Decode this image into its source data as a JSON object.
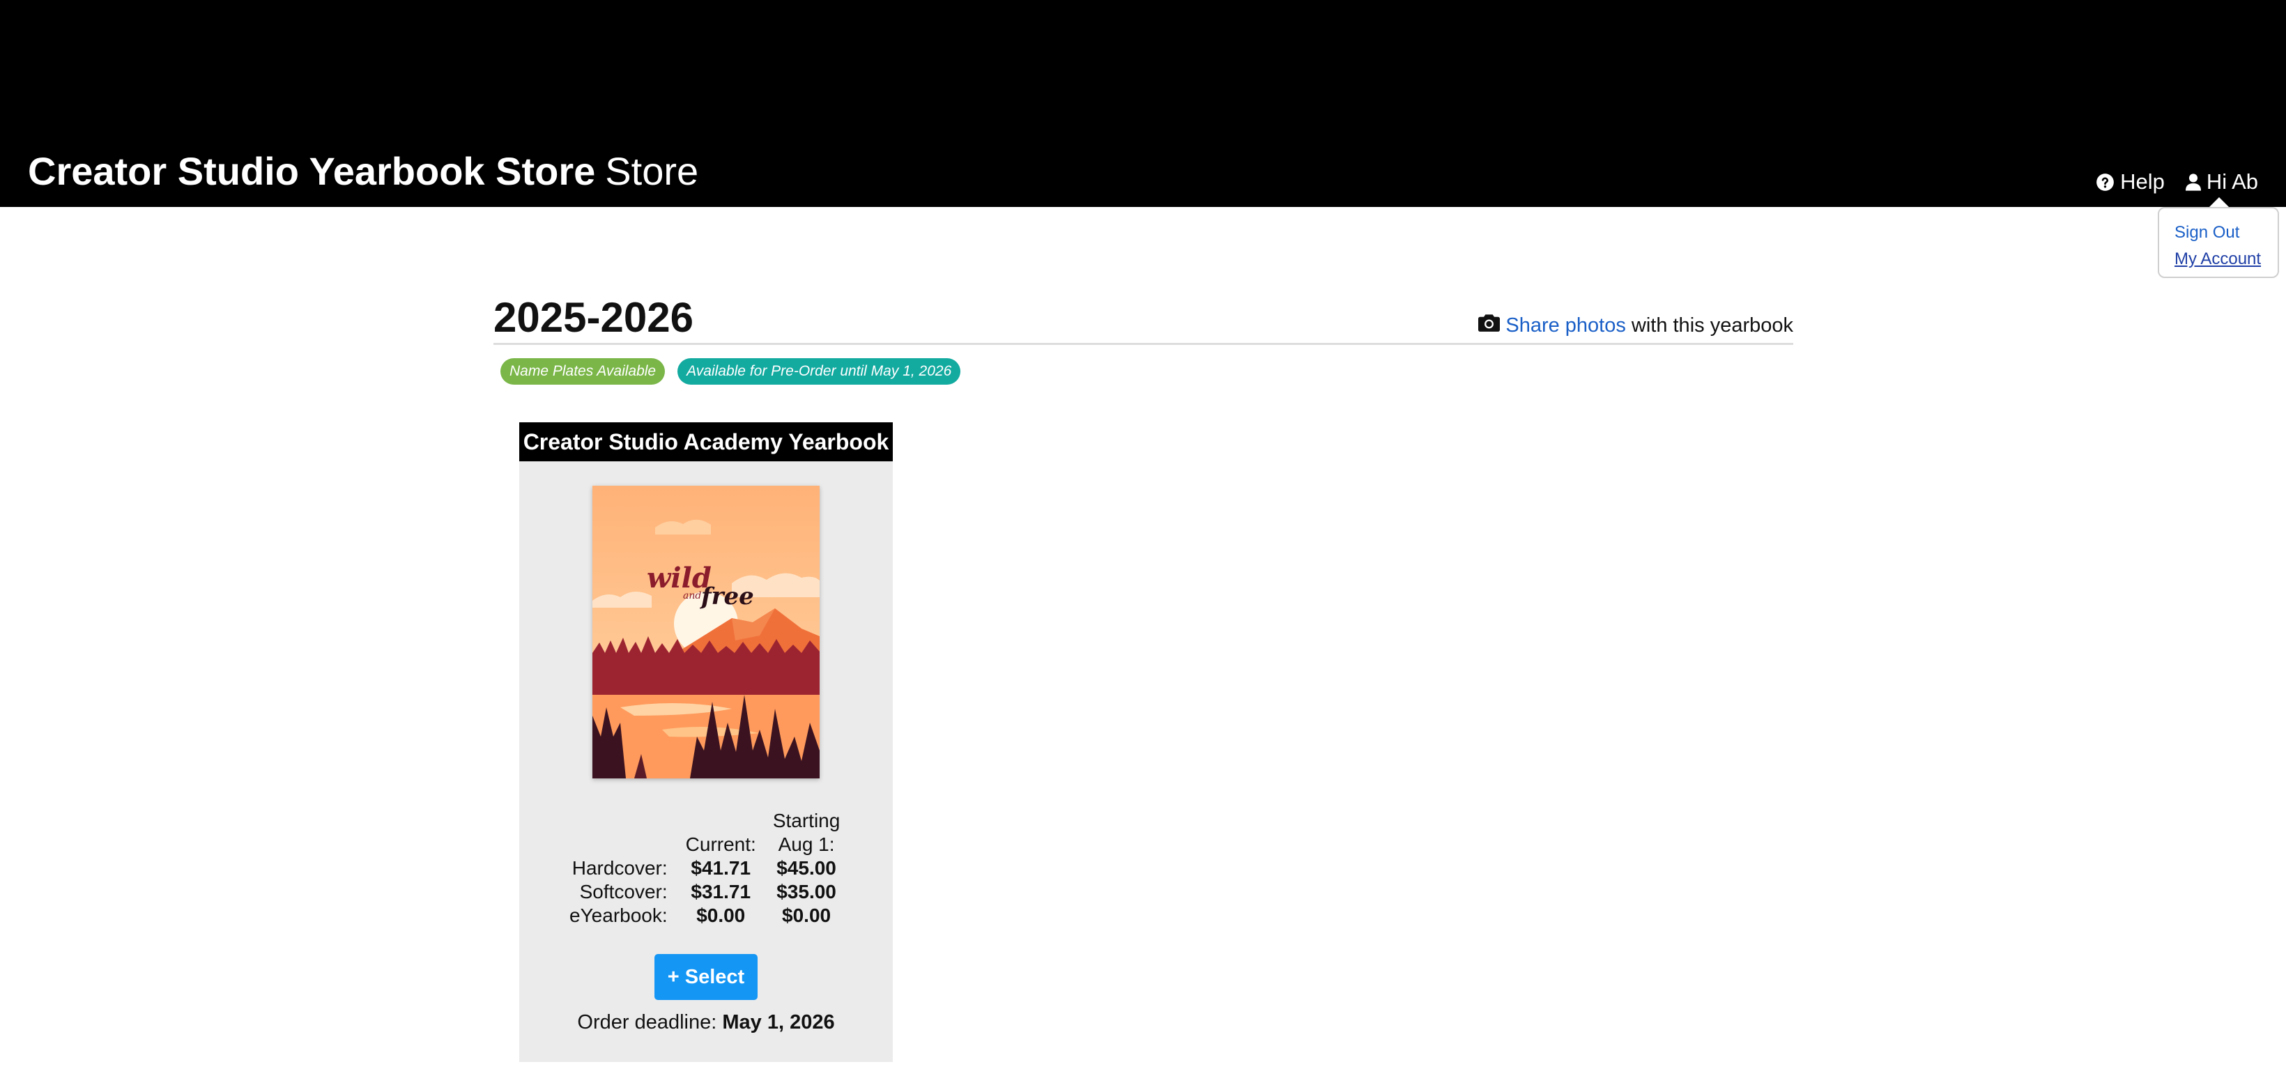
{
  "header": {
    "brand_bold": "Creator Studio Yearbook Store",
    "brand_light": "Store",
    "help_label": "Help",
    "user_label": "Hi Ab",
    "background": "#000000"
  },
  "user_menu": {
    "sign_out": "Sign Out",
    "my_account": "My Account"
  },
  "main": {
    "title": "2025-2026",
    "share_link": "Share photos",
    "share_rest": "with this yearbook",
    "badges": [
      {
        "label": "Name Plates Available",
        "color": "#7ab648"
      },
      {
        "label": "Available for Pre-Order until May 1, 2026",
        "color": "#13aaa0"
      }
    ]
  },
  "product": {
    "title": "Creator Studio Academy Yearbook",
    "cover_text_1": "wild",
    "cover_text_2": "and",
    "cover_text_3": "free",
    "price_headers": {
      "current": "Current:",
      "later_line1": "Starting",
      "later_line2": "Aug 1:"
    },
    "prices": [
      {
        "label": "Hardcover:",
        "current": "$41.71",
        "later": "$45.00"
      },
      {
        "label": "Softcover:",
        "current": "$31.71",
        "later": "$35.00"
      },
      {
        "label": "eYearbook:",
        "current": "$0.00",
        "later": "$0.00"
      }
    ],
    "select_label": "+ Select",
    "deadline_label": "Order deadline:",
    "deadline_date": "May 1, 2026",
    "accent_color": "#1496f5"
  }
}
